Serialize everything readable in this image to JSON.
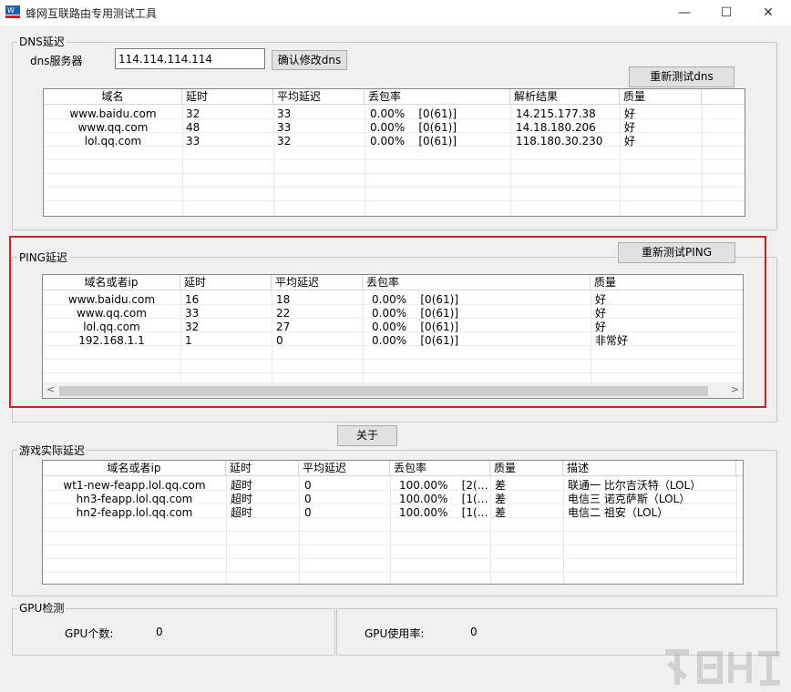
{
  "window": {
    "title": "蜂网互联路由专用测试工具",
    "minimize": "—",
    "maximize": "☐",
    "close": "✕"
  },
  "dns": {
    "group_title": "DNS延迟",
    "server_label": "dns服务器",
    "server_value": "114.114.114.114",
    "confirm_button": "确认修改dns",
    "retest_button": "重新测试dns",
    "columns": [
      "域名",
      "延时",
      "平均延迟",
      "丢包率",
      "解析结果",
      "质量"
    ],
    "rows": [
      [
        "www.baidu.com",
        "32",
        "33",
        "0.00%    [0(61)]",
        "14.215.177.38",
        "好"
      ],
      [
        "www.qq.com",
        "48",
        "33",
        "0.00%    [0(61)]",
        "14.18.180.206",
        "好"
      ],
      [
        "lol.qq.com",
        "33",
        "32",
        "0.00%    [0(61)]",
        "118.180.30.230",
        "好"
      ]
    ]
  },
  "ping": {
    "group_title": "PING延迟",
    "retest_button": "重新测试PING",
    "columns": [
      "域名或者ip",
      "延时",
      "平均延迟",
      "丢包率",
      "质量"
    ],
    "rows": [
      [
        "www.baidu.com",
        "16",
        "18",
        "0.00%    [0(61)]",
        "好"
      ],
      [
        "www.qq.com",
        "33",
        "22",
        "0.00%    [0(61)]",
        "好"
      ],
      [
        "lol.qq.com",
        "32",
        "27",
        "0.00%    [0(61)]",
        "好"
      ],
      [
        "192.168.1.1",
        "1",
        "0",
        "0.00%    [0(61)]",
        "非常好"
      ]
    ],
    "scroll_left": "<",
    "scroll_right": ">"
  },
  "about_button": "关于",
  "game": {
    "group_title": "游戏实际延迟",
    "columns": [
      "域名或者ip",
      "延时",
      "平均延迟",
      "丢包率",
      "质量",
      "描述"
    ],
    "rows": [
      [
        "wt1-new-feapp.lol.qq.com",
        "超时",
        "0",
        "100.00%    [2(…",
        "差",
        "联通一 比尔吉沃特（LOL）"
      ],
      [
        "hn3-feapp.lol.qq.com",
        "超时",
        "0",
        "100.00%    [1(…",
        "差",
        "电信三 诺克萨斯（LOL）"
      ],
      [
        "hn2-feapp.lol.qq.com",
        "超时",
        "0",
        "100.00%    [1(…",
        "差",
        "电信二 祖安（LOL）"
      ]
    ]
  },
  "gpu": {
    "group_title": "GPU检测",
    "count_label": "GPU个数:",
    "count_value": "0",
    "usage_label": "GPU使用率:",
    "usage_value": "0"
  }
}
